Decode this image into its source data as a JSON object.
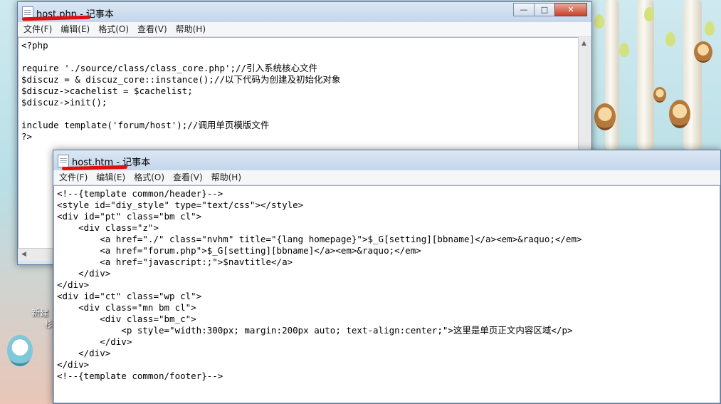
{
  "desktop": {
    "icon_label_1": "新建",
    "icon_label_2": "杉"
  },
  "window_back": {
    "title": "host.php - 记事本",
    "menu": [
      "文件(F)",
      "编辑(E)",
      "格式(O)",
      "查看(V)",
      "帮助(H)"
    ],
    "controls": {
      "minimize": "—",
      "maximize": "□",
      "close": "✕"
    },
    "content": "<?php\n\nrequire './source/class/class_core.php';//引入系统核心文件\n$discuz = & discuz_core::instance();//以下代码为创建及初始化对象\n$discuz->cachelist = $cachelist;\n$discuz->init();\n\ninclude template('forum/host');//调用单页模版文件\n?>"
  },
  "window_front": {
    "title": "host.htm - 记事本",
    "menu": [
      "文件(F)",
      "编辑(E)",
      "格式(O)",
      "查看(V)",
      "帮助(H)"
    ],
    "content": "<!--{template common/header}-->\n<style id=\"diy_style\" type=\"text/css\"></style>\n<div id=\"pt\" class=\"bm cl\">\n    <div class=\"z\">\n        <a href=\"./\" class=\"nvhm\" title=\"{lang homepage}\">$_G[setting][bbname]</a><em>&raquo;</em>\n        <a href=\"forum.php\">$_G[setting][bbname]</a><em>&raquo;</em>\n        <a href=\"javascript:;\">$navtitle</a>\n    </div>\n</div>\n<div id=\"ct\" class=\"wp cl\">\n    <div class=\"mn bm cl\">\n        <div class=\"bm_c\">\n            <p style=\"width:300px; margin:200px auto; text-align:center;\">这里是单页正文内容区域</p>\n        </div>\n    </div>\n</div>\n<!--{template common/footer}-->"
  }
}
